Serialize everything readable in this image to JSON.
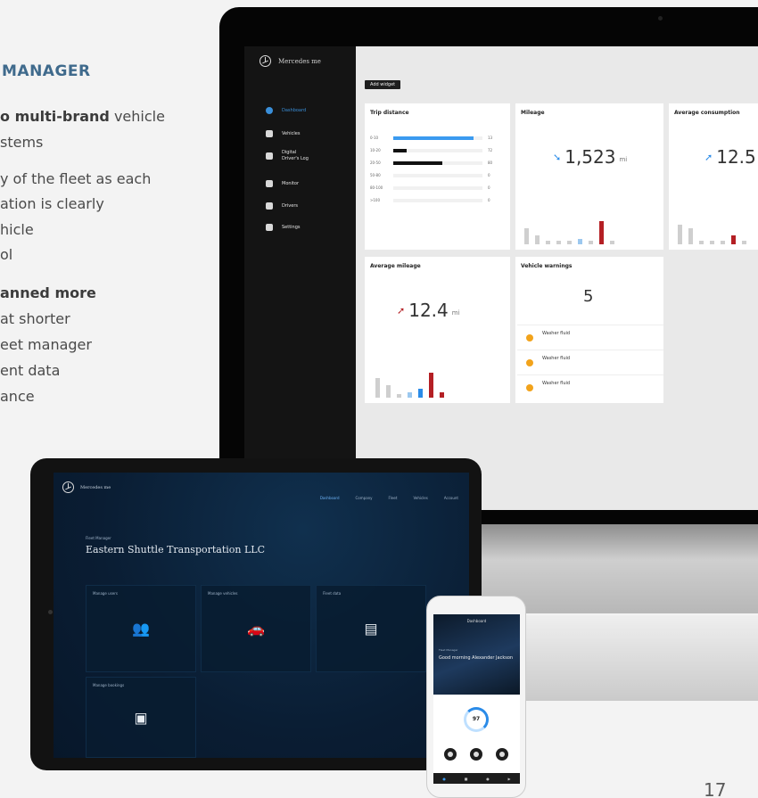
{
  "brochure": {
    "heading": "MANAGER",
    "line1_bold": "o multi-brand",
    "line1_rest": " vehicle",
    "line2": "stems",
    "line3": "y of the fleet as each",
    "line4": "ation is clearly",
    "line5": "hicle",
    "line6": "ol",
    "line7_bold": "anned more",
    "line8": "at shorter",
    "line9": "eet manager",
    "line10": "ent data",
    "line11": "ance",
    "page_number": "17"
  },
  "monitor_app": {
    "brand": "Mercedes me",
    "nav": [
      {
        "label": "Dashboard",
        "icon": "dashboard-icon"
      },
      {
        "label": "Vehicles",
        "icon": "vehicles-icon"
      },
      {
        "label": "Digital Driver's Log",
        "icon": "log-icon"
      },
      {
        "label": "Monitor",
        "icon": "monitor-icon"
      },
      {
        "label": "Drivers",
        "icon": "drivers-icon"
      },
      {
        "label": "Settings",
        "icon": "gear-icon"
      }
    ],
    "add_widget": "Add widget",
    "trip_distance": {
      "title": "Trip distance",
      "rows": [
        {
          "label": "0-10",
          "pct": 0.9,
          "color": "#3a9af0",
          "num": "13"
        },
        {
          "label": "10-20",
          "pct": 0.15,
          "color": "#111111",
          "num": "72"
        },
        {
          "label": "20-50",
          "pct": 0.55,
          "color": "#111111",
          "num": "80"
        },
        {
          "label": "50-80",
          "pct": 0,
          "color": "#111111",
          "num": "0"
        },
        {
          "label": "80-100",
          "pct": 0,
          "color": "#111111",
          "num": "0"
        },
        {
          "label": ">100",
          "pct": 0,
          "color": "#111111",
          "num": "0"
        }
      ]
    },
    "mileage": {
      "title": "Mileage",
      "value": "1,523",
      "unit": "mi"
    },
    "avg_consumption": {
      "title": "Average consumption",
      "value": "12.5"
    },
    "avg_mileage": {
      "title": "Average mileage",
      "value": "12.4",
      "unit": "mi"
    },
    "vehicle_warnings": {
      "title": "Vehicle warnings",
      "count": "5",
      "items": [
        {
          "title": "Washer fluid"
        },
        {
          "title": "Washer fluid"
        },
        {
          "title": "Washer fluid"
        }
      ]
    }
  },
  "tablet_app": {
    "brand": "Mercedes me",
    "nav": [
      "Dashboard",
      "Company",
      "Fleet",
      "Vehicles",
      "Account"
    ],
    "welcome_small": "Fleet Manager",
    "company": "Eastern Shuttle Transportation LLC",
    "tiles": [
      {
        "label": "Manage users",
        "icon": "users-icon",
        "glyph": "👥"
      },
      {
        "label": "Manage vehicles",
        "icon": "car-icon",
        "glyph": "🚗"
      },
      {
        "label": "Fleet data",
        "icon": "document-icon",
        "glyph": "▤"
      },
      {
        "label": "Manage bookings",
        "icon": "booking-icon",
        "glyph": "▣"
      }
    ]
  },
  "phone_app": {
    "title": "Dashboard",
    "company_small": "Fleet Manager",
    "greeting": "Good morning Alexander Jackson",
    "gauge_value": "97"
  }
}
